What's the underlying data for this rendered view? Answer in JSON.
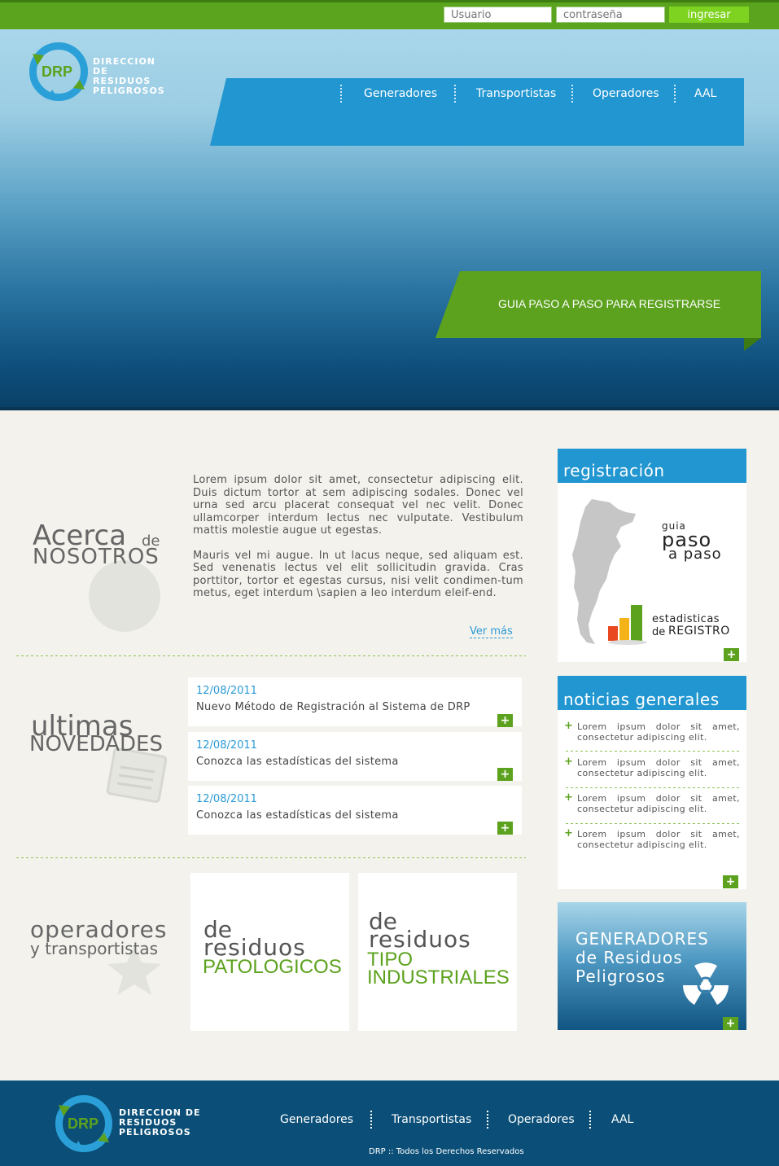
{
  "login": {
    "username_placeholder": "Usuario",
    "password_placeholder": "contraseña",
    "submit_label": "ingresar"
  },
  "brand": {
    "abbrev": "DRP",
    "name_lines": [
      "DIRECCION DE",
      "RESIDUOS",
      "PELIGROSOS"
    ]
  },
  "nav": [
    "Generadores",
    "Transportistas",
    "Operadores",
    "AAL"
  ],
  "hero": {
    "guide_label": "GUIA PASO A PASO PARA REGISTRARSE"
  },
  "about": {
    "title_big": "Acerca",
    "title_small": "de",
    "title_caps": "NOSOTROS",
    "paragraphs": [
      "Lorem ipsum dolor sit amet, consectetur adipiscing elit. Duis dictum tortor at sem adipiscing sodales. Donec vel urna sed arcu placerat consequat vel nec velit. Donec ullamcorper interdum lectus nec vulputate. Vestibulum mattis molestie augue ut egestas.",
      "Mauris vel mi augue. In ut lacus neque, sed aliquam est. Sed venenatis lectus vel elit sollicitudin gravida. Cras porttitor, tortor et egestas cursus, nisi velit condimen-tum metus, eget interdum \\sapien a leo interdum eleif-end."
    ],
    "more_link": "Ver más"
  },
  "news_section": {
    "title_big": "ultimas",
    "title_caps": "NOVEDADES",
    "items": [
      {
        "date": "12/08/2011",
        "title": "Nuevo Método de Registración al Sistema de DRP"
      },
      {
        "date": "12/08/2011",
        "title": "Conozca las estadísticas del sistema"
      },
      {
        "date": "12/08/2011",
        "title": "Conozca las estadísticas del sistema"
      }
    ]
  },
  "operators": {
    "title_big": "operadores",
    "title_small": "y transportistas",
    "tiles": [
      {
        "line1": "de",
        "line2": "residuos",
        "line3": "PATOLOGICOS",
        "line4": ""
      },
      {
        "line1": "de",
        "line2": "residuos",
        "line3": "TIPO",
        "line4": "INDUSTRIALES"
      }
    ]
  },
  "registration_panel": {
    "title": "registración",
    "guide_small": "guia",
    "guide_big": "paso",
    "guide_rest": "a paso",
    "stats_line1": "estadisticas",
    "stats_prefix": "de",
    "stats_caps": "REGISTRO"
  },
  "general_news": {
    "title": "noticias generales",
    "items": [
      "Lorem ipsum dolor sit amet, consectetur adipiscing elit.",
      "Lorem ipsum dolor sit amet, consectetur adipiscing elit.",
      "Lorem ipsum dolor sit amet, consectetur adipiscing elit.",
      "Lorem ipsum dolor sit amet, consectetur adipiscing elit."
    ]
  },
  "generators_panel": {
    "lines": [
      "GENERADORES",
      "de Residuos",
      "Peligrosos"
    ]
  },
  "footer": {
    "copyright": "DRP :: Todos los Derechos Reservados"
  },
  "plus_symbol": "+",
  "colors": {
    "green": "#5ca21e",
    "blue": "#2196d0",
    "navy": "#0b4f78",
    "text_gray": "#666666"
  }
}
